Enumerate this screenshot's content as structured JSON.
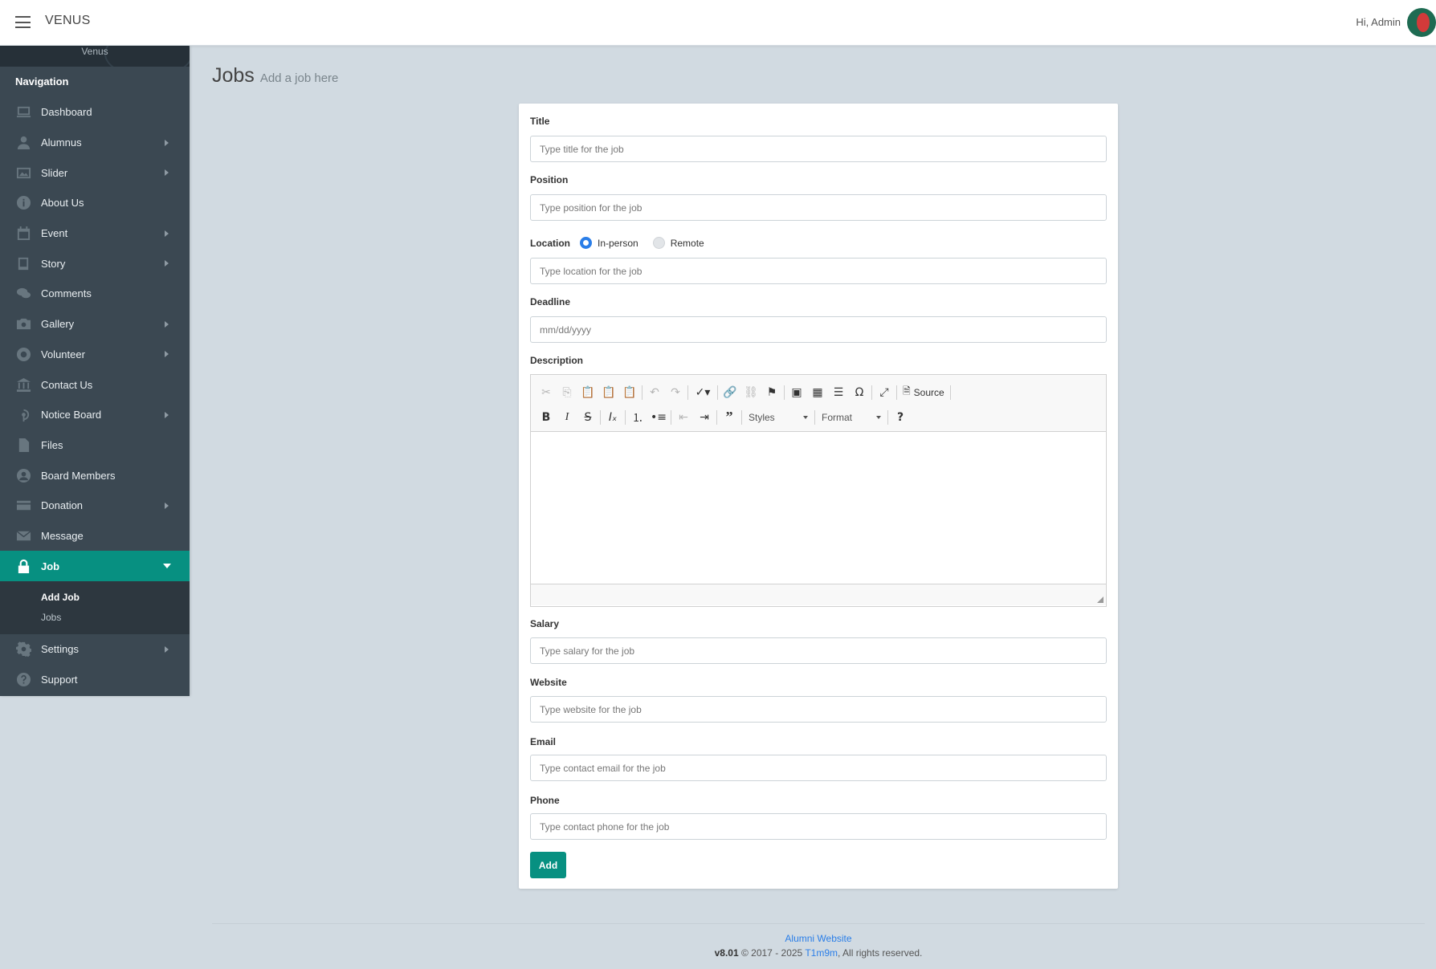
{
  "header": {
    "brand": "VENUS",
    "greeting": "Hi, Admin"
  },
  "sidebar": {
    "caption": "Venus",
    "heading": "Navigation",
    "items": [
      {
        "label": "Dashboard",
        "icon": "monitor-icon"
      },
      {
        "label": "Alumnus",
        "icon": "user-icon"
      },
      {
        "label": "Slider",
        "icon": "image-icon"
      },
      {
        "label": "About Us",
        "icon": "info-icon"
      },
      {
        "label": "Event",
        "icon": "calendar-icon"
      },
      {
        "label": "Story",
        "icon": "book-icon"
      },
      {
        "label": "Comments",
        "icon": "comments-icon"
      },
      {
        "label": "Gallery",
        "icon": "camera-icon"
      },
      {
        "label": "Volunteer",
        "icon": "lifebuoy-icon"
      },
      {
        "label": "Contact Us",
        "icon": "bank-icon"
      },
      {
        "label": "Notice Board",
        "icon": "broadcast-icon"
      },
      {
        "label": "Files",
        "icon": "file-icon"
      },
      {
        "label": "Board Members",
        "icon": "user-circle-icon"
      },
      {
        "label": "Donation",
        "icon": "credit-card-icon"
      },
      {
        "label": "Message",
        "icon": "envelope-icon"
      },
      {
        "label": "Job",
        "icon": "lock-icon"
      },
      {
        "label": "Settings",
        "icon": "gear-icon"
      },
      {
        "label": "Support",
        "icon": "question-icon"
      }
    ],
    "job_submenu": [
      "Add Job",
      "Jobs"
    ]
  },
  "page": {
    "title": "Jobs",
    "subtitle": "Add a job here"
  },
  "form": {
    "title_label": "Title",
    "title_placeholder": "Type title for the job",
    "position_label": "Position",
    "position_placeholder": "Type position for the job",
    "location_label": "Location",
    "location_option_inperson": "In-person",
    "location_option_remote": "Remote",
    "location_placeholder": "Type location for the job",
    "deadline_label": "Deadline",
    "deadline_placeholder": "mm/dd/yyyy",
    "description_label": "Description",
    "editor": {
      "source_label": "Source",
      "styles_label": "Styles",
      "format_label": "Format"
    },
    "salary_label": "Salary",
    "salary_placeholder": "Type salary for the job",
    "website_label": "Website",
    "website_placeholder": "Type website for the job",
    "email_label": "Email",
    "email_placeholder": "Type contact email for the job",
    "phone_label": "Phone",
    "phone_placeholder": "Type contact phone for the job",
    "submit_label": "Add"
  },
  "footer": {
    "site_link": "Alumni Website",
    "version": "v8.01",
    "copyright": "© 2017 - 2025",
    "author": "T1m9m",
    "rights": ", All rights reserved."
  },
  "colors": {
    "accent": "#079081",
    "sidebar_bg": "#3b4852",
    "page_bg": "#d1dae1",
    "link": "#2a7ee8"
  }
}
